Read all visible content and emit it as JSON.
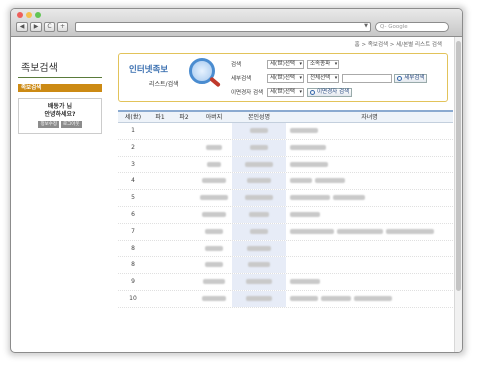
{
  "browser": {
    "nav_back": "◀",
    "nav_forward": "▶",
    "reload": "C",
    "add": "+",
    "search_placeholder": "Q- Google"
  },
  "breadcrumb": "홈 > 족보검색 > 세/본별 리스트 검색",
  "sidebar": {
    "title": "족보검색",
    "menu_item": "족보검색",
    "greet_line1": "배동가 님",
    "greet_line2": "안녕하세요?",
    "btn_info": "정보수정",
    "btn_logout": "로그아웃"
  },
  "panel": {
    "brand_title": "인터넷족보",
    "brand_sub": "리스트/검색",
    "row1_label": "검색",
    "row1_sel1": "세(世)선택",
    "row1_sel2": "소속종파",
    "row2_label": "세부검색",
    "row2_sel1": "세(世)선택",
    "row2_sel2": "전체선택",
    "row2_btn": "세부검색",
    "row3_label": "이면경자 검색",
    "row3_sel1": "세(世)선택",
    "row3_btn": "이면경자 검색"
  },
  "table": {
    "headers": [
      "세(世)",
      "파1",
      "파2",
      "아버지",
      "본인성명",
      "자녀명"
    ],
    "rows": [
      {
        "gen": "1"
      },
      {
        "gen": "2"
      },
      {
        "gen": "3"
      },
      {
        "gen": "4"
      },
      {
        "gen": "5"
      },
      {
        "gen": "6"
      },
      {
        "gen": "7"
      },
      {
        "gen": "8"
      },
      {
        "gen": "8"
      },
      {
        "gen": "9"
      },
      {
        "gen": "10"
      }
    ]
  }
}
